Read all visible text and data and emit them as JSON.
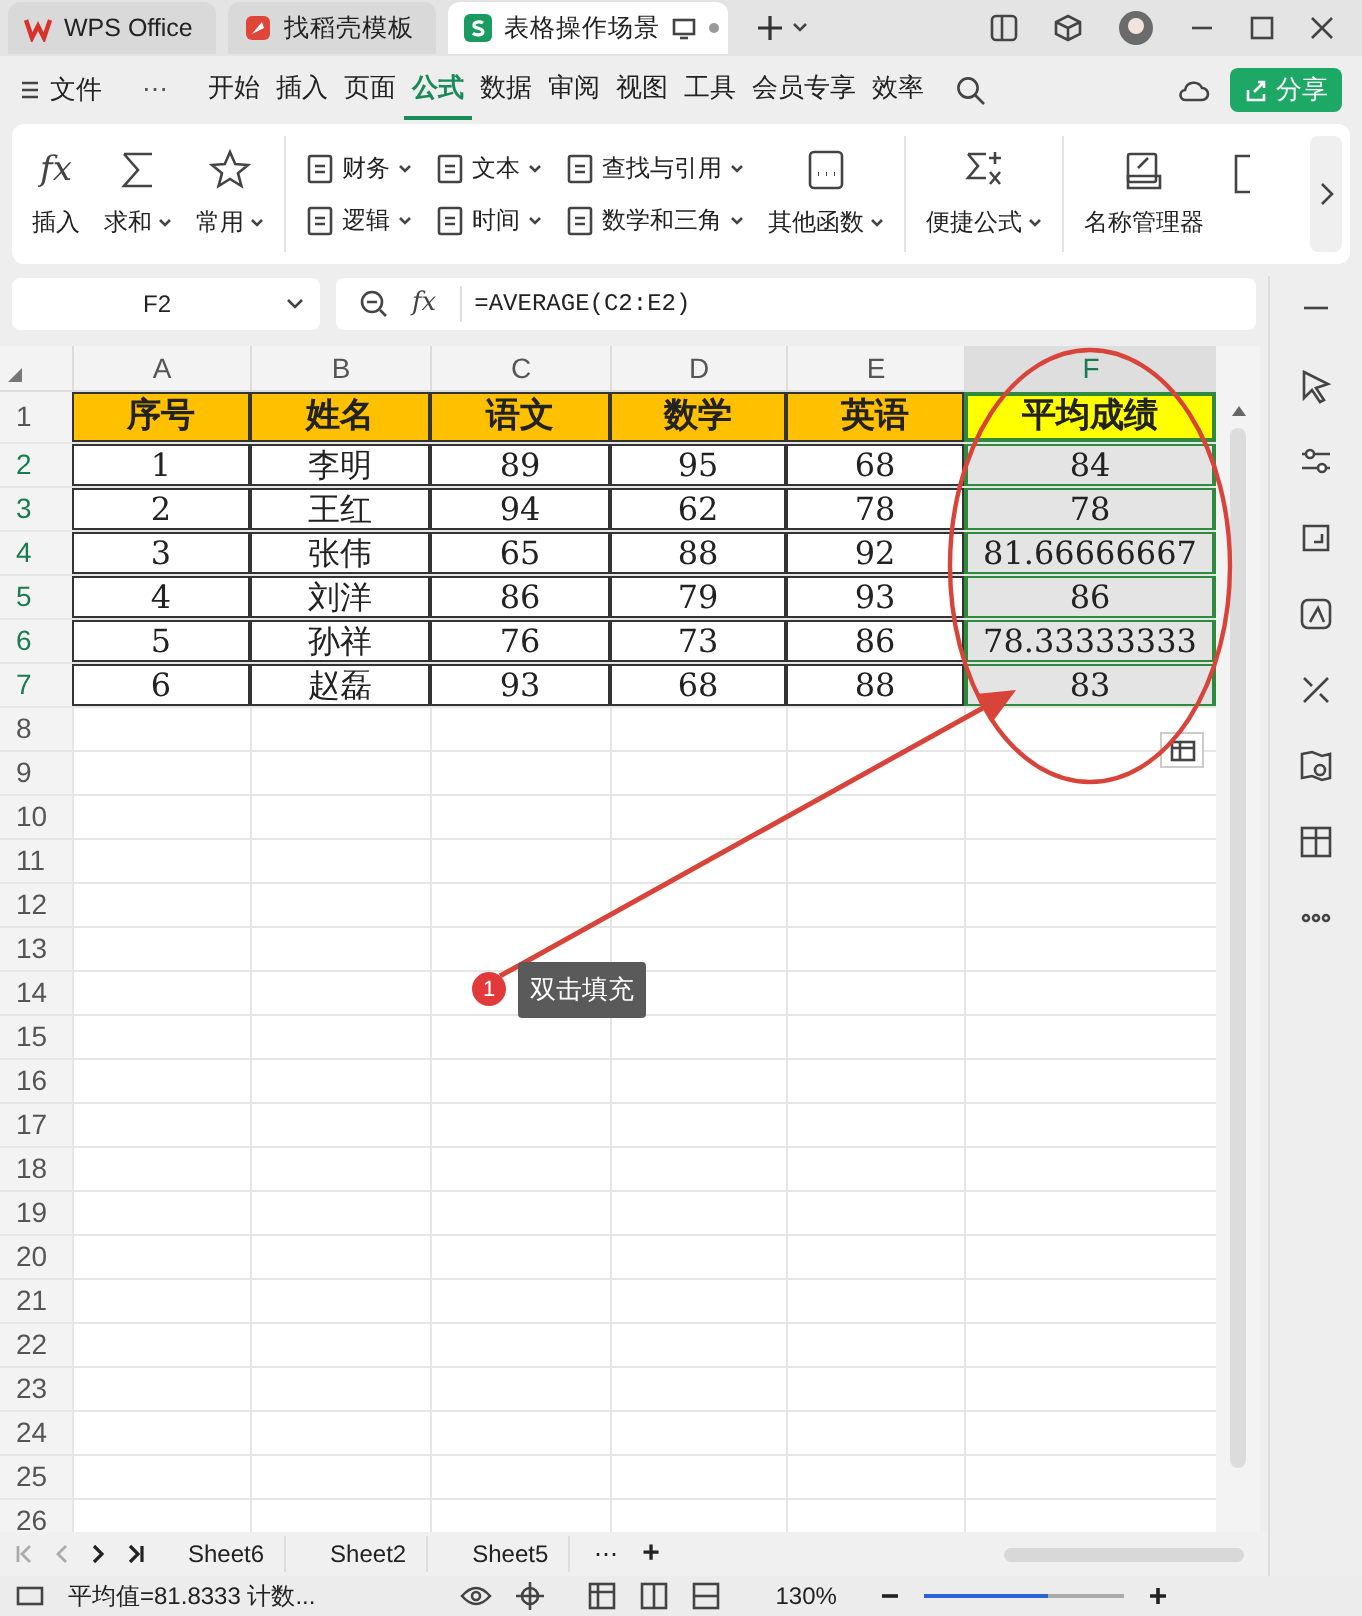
{
  "window_tabs": [
    {
      "label": "WPS Office",
      "selected": false
    },
    {
      "label": "找稻壳模板",
      "selected": false
    },
    {
      "label": "表格操作场景",
      "selected": true
    }
  ],
  "menu": {
    "file": "文件",
    "more": "⋯",
    "tabs": [
      {
        "label": "开始",
        "selected": false
      },
      {
        "label": "插入",
        "selected": false
      },
      {
        "label": "页面",
        "selected": false
      },
      {
        "label": "公式",
        "selected": true
      },
      {
        "label": "数据",
        "selected": false
      },
      {
        "label": "审阅",
        "selected": false
      },
      {
        "label": "视图",
        "selected": false
      },
      {
        "label": "工具",
        "selected": false
      },
      {
        "label": "会员专享",
        "selected": false
      },
      {
        "label": "效率",
        "selected": false
      }
    ],
    "share": "分享"
  },
  "ribbon": {
    "groups": [
      {
        "items": [
          {
            "kind": "large",
            "label": "插入",
            "dropdown": false,
            "glyph": "fx"
          },
          {
            "kind": "large",
            "label": "求和",
            "dropdown": true
          },
          {
            "kind": "large",
            "label": "常用",
            "dropdown": true
          }
        ]
      },
      {
        "items": [
          {
            "kind": "small",
            "label": "财务",
            "dropdown": true
          },
          {
            "kind": "small",
            "label": "逻辑",
            "dropdown": true
          },
          {
            "kind": "small",
            "label": "文本",
            "dropdown": true
          },
          {
            "kind": "small",
            "label": "时间",
            "dropdown": true
          },
          {
            "kind": "small",
            "label": "查找与引用",
            "dropdown": true
          },
          {
            "kind": "small",
            "label": "数学和三角",
            "dropdown": true
          },
          {
            "kind": "large",
            "label": "其他函数",
            "dropdown": true
          }
        ]
      },
      {
        "items": [
          {
            "kind": "large",
            "label": "便捷公式",
            "dropdown": true
          }
        ]
      },
      {
        "items": [
          {
            "kind": "large",
            "label": "名称管理器",
            "dropdown": false
          }
        ]
      }
    ]
  },
  "formula_bar": {
    "name_box": "F2",
    "fx": "fx",
    "formula": "=AVERAGE(C2:E2)"
  },
  "sheet": {
    "columns": [
      {
        "label": "A",
        "selected": false
      },
      {
        "label": "B",
        "selected": false
      },
      {
        "label": "C",
        "selected": false
      },
      {
        "label": "D",
        "selected": false
      },
      {
        "label": "E",
        "selected": false
      },
      {
        "label": "F",
        "selected": true
      }
    ],
    "row_numbers": [
      {
        "label": "1",
        "selected": false
      },
      {
        "label": "2",
        "selected": true
      },
      {
        "label": "3",
        "selected": true
      },
      {
        "label": "4",
        "selected": true
      },
      {
        "label": "5",
        "selected": true
      },
      {
        "label": "6",
        "selected": true
      },
      {
        "label": "7",
        "selected": true
      },
      {
        "label": "8",
        "selected": false
      },
      {
        "label": "9",
        "selected": false
      },
      {
        "label": "10",
        "selected": false
      },
      {
        "label": "11",
        "selected": false
      },
      {
        "label": "12",
        "selected": false
      },
      {
        "label": "13",
        "selected": false
      },
      {
        "label": "14",
        "selected": false
      },
      {
        "label": "15",
        "selected": false
      },
      {
        "label": "16",
        "selected": false
      },
      {
        "label": "17",
        "selected": false
      },
      {
        "label": "18",
        "selected": false
      },
      {
        "label": "19",
        "selected": false
      },
      {
        "label": "20",
        "selected": false
      },
      {
        "label": "21",
        "selected": false
      },
      {
        "label": "22",
        "selected": false
      },
      {
        "label": "23",
        "selected": false
      },
      {
        "label": "24",
        "selected": false
      },
      {
        "label": "25",
        "selected": false
      },
      {
        "label": "26",
        "selected": false
      }
    ],
    "header": [
      {
        "text": "序号",
        "color": "#ffc000"
      },
      {
        "text": "姓名",
        "color": "#ffc000"
      },
      {
        "text": "语文",
        "color": "#ffc000"
      },
      {
        "text": "数学",
        "color": "#ffc000"
      },
      {
        "text": "英语",
        "color": "#ffc000"
      },
      {
        "text": "平均成绩",
        "color": "#ffff00"
      }
    ],
    "rows": [
      [
        "1",
        "李明",
        "89",
        "95",
        "68",
        "84"
      ],
      [
        "2",
        "王红",
        "94",
        "62",
        "78",
        "78"
      ],
      [
        "3",
        "张伟",
        "65",
        "88",
        "92",
        "81.66666667"
      ],
      [
        "4",
        "刘洋",
        "86",
        "79",
        "93",
        "86"
      ],
      [
        "5",
        "孙祥",
        "76",
        "73",
        "86",
        "78.33333333"
      ],
      [
        "6",
        "赵磊",
        "93",
        "68",
        "88",
        "83"
      ]
    ]
  },
  "annotation": {
    "badge": "1",
    "label": "双击填充"
  },
  "sheet_tabs": [
    {
      "label": "Sheet6"
    },
    {
      "label": "Sheet2"
    },
    {
      "label": "Sheet5"
    }
  ],
  "sheet_tab_more": "⋯",
  "sheet_tab_add": "+",
  "status_bar": {
    "summary": "平均值=81.8333 计数...",
    "zoom": "130%",
    "zoom_slider": {
      "level": 0.62
    }
  }
}
